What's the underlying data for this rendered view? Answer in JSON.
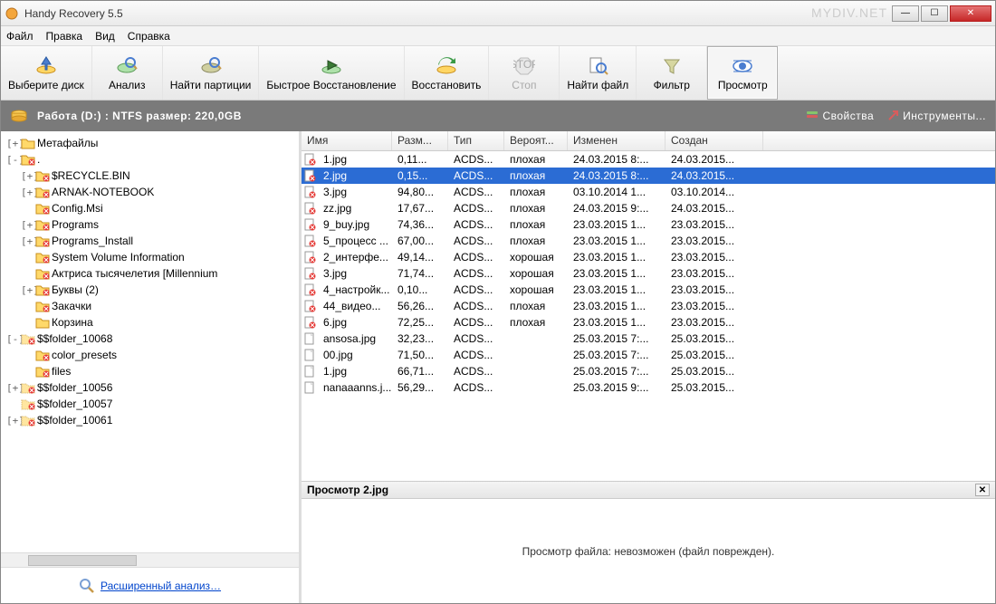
{
  "window": {
    "title": "Handy Recovery 5.5",
    "watermark": "MYDIV.NET"
  },
  "menu": [
    "Файл",
    "Правка",
    "Вид",
    "Справка"
  ],
  "toolbar": [
    {
      "id": "select-disk",
      "label": "Выберите диск"
    },
    {
      "id": "analyze",
      "label": "Анализ"
    },
    {
      "id": "find-partitions",
      "label": "Найти партиции"
    },
    {
      "id": "quick-recovery",
      "label": "Быстрое Восстановление"
    },
    {
      "id": "recover",
      "label": "Восстановить"
    },
    {
      "id": "stop",
      "label": "Стоп",
      "disabled": true
    },
    {
      "id": "find-file",
      "label": "Найти файл"
    },
    {
      "id": "filter",
      "label": "Фильтр"
    },
    {
      "id": "preview",
      "label": "Просмотр",
      "active": true
    }
  ],
  "drivebar": {
    "text": "Работа (D:) : NTFS размер: 220,0GB",
    "properties": "Свойства",
    "tools": "Инструменты..."
  },
  "tree": [
    {
      "ind": 0,
      "tw": "+",
      "type": "folder",
      "label": "Метафайлы"
    },
    {
      "ind": 0,
      "tw": "-",
      "type": "folder-del",
      "label": "."
    },
    {
      "ind": 1,
      "tw": "+",
      "type": "folder-del",
      "label": "$RECYCLE.BIN"
    },
    {
      "ind": 1,
      "tw": "+",
      "type": "folder-del",
      "label": "ARNAK-NOTEBOOK"
    },
    {
      "ind": 1,
      "tw": "",
      "type": "folder-del",
      "label": "Config.Msi"
    },
    {
      "ind": 1,
      "tw": "+",
      "type": "folder-del",
      "label": "Programs"
    },
    {
      "ind": 1,
      "tw": "+",
      "type": "folder-del",
      "label": "Programs_Install"
    },
    {
      "ind": 1,
      "tw": "",
      "type": "folder-del",
      "label": "System Volume Information"
    },
    {
      "ind": 1,
      "tw": "",
      "type": "folder-del",
      "label": "Актриса тысячелетия [Millennium"
    },
    {
      "ind": 1,
      "tw": "+",
      "type": "folder-del",
      "label": "Буквы (2)"
    },
    {
      "ind": 1,
      "tw": "",
      "type": "folder-del",
      "label": "Закачки"
    },
    {
      "ind": 1,
      "tw": "",
      "type": "folder",
      "label": "Корзина"
    },
    {
      "ind": 0,
      "tw": "-",
      "type": "folder-gh",
      "label": "$$folder_10068"
    },
    {
      "ind": 1,
      "tw": "",
      "type": "folder-del",
      "label": "color_presets"
    },
    {
      "ind": 1,
      "tw": "",
      "type": "folder-del",
      "label": "files"
    },
    {
      "ind": 0,
      "tw": "+",
      "type": "folder-gh",
      "label": "$$folder_10056"
    },
    {
      "ind": 0,
      "tw": "",
      "type": "folder-gh",
      "label": "$$folder_10057"
    },
    {
      "ind": 0,
      "tw": "+",
      "type": "folder-gh",
      "label": "$$folder_10061"
    }
  ],
  "analysis_link": "Расширенный анализ…",
  "columns": {
    "name": "Имя",
    "size": "Разм...",
    "type": "Тип",
    "prob": "Вероят...",
    "mod": "Изменен",
    "crt": "Создан"
  },
  "files": [
    {
      "icon": "del",
      "name": "1.jpg",
      "size": "0,11...",
      "type": "ACDS...",
      "prob": "плохая",
      "mod": "24.03.2015 8:...",
      "crt": "24.03.2015..."
    },
    {
      "icon": "del",
      "name": "2.jpg",
      "size": "0,15...",
      "type": "ACDS...",
      "prob": "плохая",
      "mod": "24.03.2015 8:...",
      "crt": "24.03.2015...",
      "selected": true
    },
    {
      "icon": "del",
      "name": "3.jpg",
      "size": "94,80...",
      "type": "ACDS...",
      "prob": "плохая",
      "mod": "03.10.2014 1...",
      "crt": "03.10.2014..."
    },
    {
      "icon": "del",
      "name": "zz.jpg",
      "size": "17,67...",
      "type": "ACDS...",
      "prob": "плохая",
      "mod": "24.03.2015 9:...",
      "crt": "24.03.2015..."
    },
    {
      "icon": "del",
      "name": "9_buy.jpg",
      "size": "74,36...",
      "type": "ACDS...",
      "prob": "плохая",
      "mod": "23.03.2015 1...",
      "crt": "23.03.2015..."
    },
    {
      "icon": "del",
      "name": "5_процесс ...",
      "size": "67,00...",
      "type": "ACDS...",
      "prob": "плохая",
      "mod": "23.03.2015 1...",
      "crt": "23.03.2015..."
    },
    {
      "icon": "del",
      "name": "2_интерфе...",
      "size": "49,14...",
      "type": "ACDS...",
      "prob": "хорошая",
      "mod": "23.03.2015 1...",
      "crt": "23.03.2015..."
    },
    {
      "icon": "del",
      "name": "3.jpg",
      "size": "71,74...",
      "type": "ACDS...",
      "prob": "хорошая",
      "mod": "23.03.2015 1...",
      "crt": "23.03.2015..."
    },
    {
      "icon": "del",
      "name": "4_настройк...",
      "size": "0,10...",
      "type": "ACDS...",
      "prob": "хорошая",
      "mod": "23.03.2015 1...",
      "crt": "23.03.2015..."
    },
    {
      "icon": "del",
      "name": "44_видео...",
      "size": "56,26...",
      "type": "ACDS...",
      "prob": "плохая",
      "mod": "23.03.2015 1...",
      "crt": "23.03.2015..."
    },
    {
      "icon": "del",
      "name": "6.jpg",
      "size": "72,25...",
      "type": "ACDS...",
      "prob": "плохая",
      "mod": "23.03.2015 1...",
      "crt": "23.03.2015..."
    },
    {
      "icon": "file",
      "name": "ansosa.jpg",
      "size": "32,23...",
      "type": "ACDS...",
      "prob": "",
      "mod": "25.03.2015 7:...",
      "crt": "25.03.2015..."
    },
    {
      "icon": "file",
      "name": "00.jpg",
      "size": "71,50...",
      "type": "ACDS...",
      "prob": "",
      "mod": "25.03.2015 7:...",
      "crt": "25.03.2015..."
    },
    {
      "icon": "file",
      "name": "1.jpg",
      "size": "66,71...",
      "type": "ACDS...",
      "prob": "",
      "mod": "25.03.2015 7:...",
      "crt": "25.03.2015..."
    },
    {
      "icon": "file",
      "name": "nanaaanns.j...",
      "size": "56,29...",
      "type": "ACDS...",
      "prob": "",
      "mod": "25.03.2015 9:...",
      "crt": "25.03.2015..."
    }
  ],
  "preview": {
    "title": "Просмотр 2.jpg",
    "message": "Просмотр файла: невозможен (файл поврежден)."
  }
}
